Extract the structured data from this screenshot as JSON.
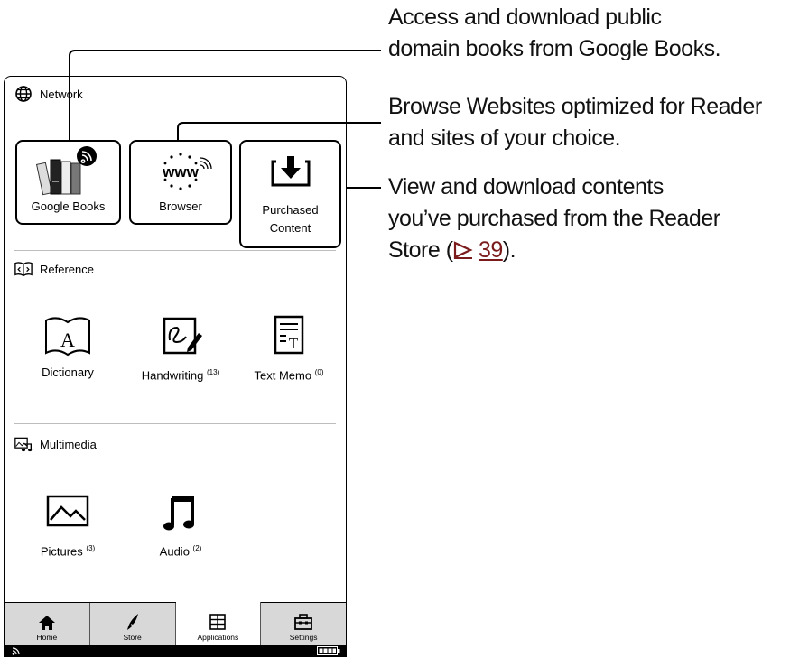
{
  "sections": {
    "network": {
      "title": "Network",
      "icon": "globe-icon"
    },
    "reference": {
      "title": "Reference",
      "icon": "book-code-icon"
    },
    "multimedia": {
      "title": "Multimedia",
      "icon": "picture-music-icon"
    }
  },
  "apps": {
    "google_books": {
      "label": "Google Books",
      "icon": "books-wireless-icon"
    },
    "browser": {
      "label": "Browser",
      "icon": "www-icon"
    },
    "purchased": {
      "label_line1": "Purchased",
      "label_line2": "Content",
      "icon": "download-tray-icon"
    },
    "dictionary": {
      "label": "Dictionary",
      "icon": "dictionary-book-icon"
    },
    "handwriting": {
      "label": "Handwriting",
      "count": "(13)",
      "icon": "pen-note-icon"
    },
    "text_memo": {
      "label": "Text Memo",
      "count": "(0)",
      "icon": "text-memo-icon"
    },
    "pictures": {
      "label": "Pictures",
      "count": "(3)",
      "icon": "picture-icon"
    },
    "audio": {
      "label": "Audio",
      "count": "(2)",
      "icon": "music-note-icon"
    }
  },
  "tabs": [
    {
      "label": "Home",
      "icon": "home-icon"
    },
    {
      "label": "Store",
      "icon": "store-leaf-icon"
    },
    {
      "label": "Applications",
      "icon": "applications-icon",
      "active": true
    },
    {
      "label": "Settings",
      "icon": "toolbox-icon"
    }
  ],
  "annotations": {
    "google_books": [
      "Access and download public",
      "domain books from Google Books."
    ],
    "browser": [
      "Browse Websites optimized for Reader",
      "and sites of your choice."
    ],
    "purchased": [
      "View and download contents",
      "you’ve purchased from the Reader"
    ],
    "purchased_last_prefix": "Store (",
    "purchased_ref": "39",
    "purchased_last_suffix": ")."
  }
}
